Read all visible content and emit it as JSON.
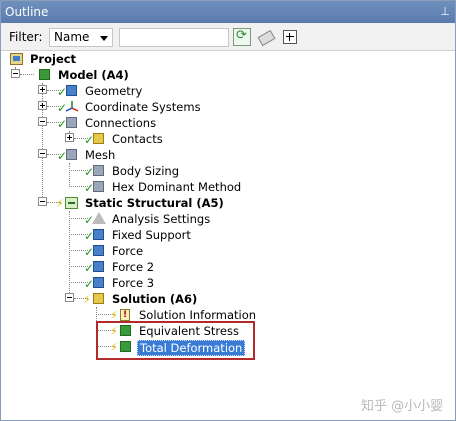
{
  "panel": {
    "title": "Outline",
    "pin_icon": "pin-icon"
  },
  "toolbar": {
    "filter_label": "Filter:",
    "filter_value": "Name",
    "search_value": ""
  },
  "tree": {
    "project": "Project",
    "model": "Model (A4)",
    "geometry": "Geometry",
    "coordinate_systems": "Coordinate Systems",
    "connections": "Connections",
    "contacts": "Contacts",
    "mesh": "Mesh",
    "body_sizing": "Body Sizing",
    "hex_dominant": "Hex Dominant Method",
    "static_structural": "Static Structural (A5)",
    "analysis_settings": "Analysis Settings",
    "fixed_support": "Fixed Support",
    "force": "Force",
    "force2": "Force 2",
    "force3": "Force 3",
    "solution": "Solution (A6)",
    "solution_information": "Solution Information",
    "equivalent_stress": "Equivalent Stress",
    "total_deformation": "Total Deformation"
  },
  "watermark": "知乎 @小小婴",
  "colors": {
    "selection": "#3a7bd5",
    "highlight_box": "#b22a2a",
    "titlebar": "#6f8fbd"
  }
}
